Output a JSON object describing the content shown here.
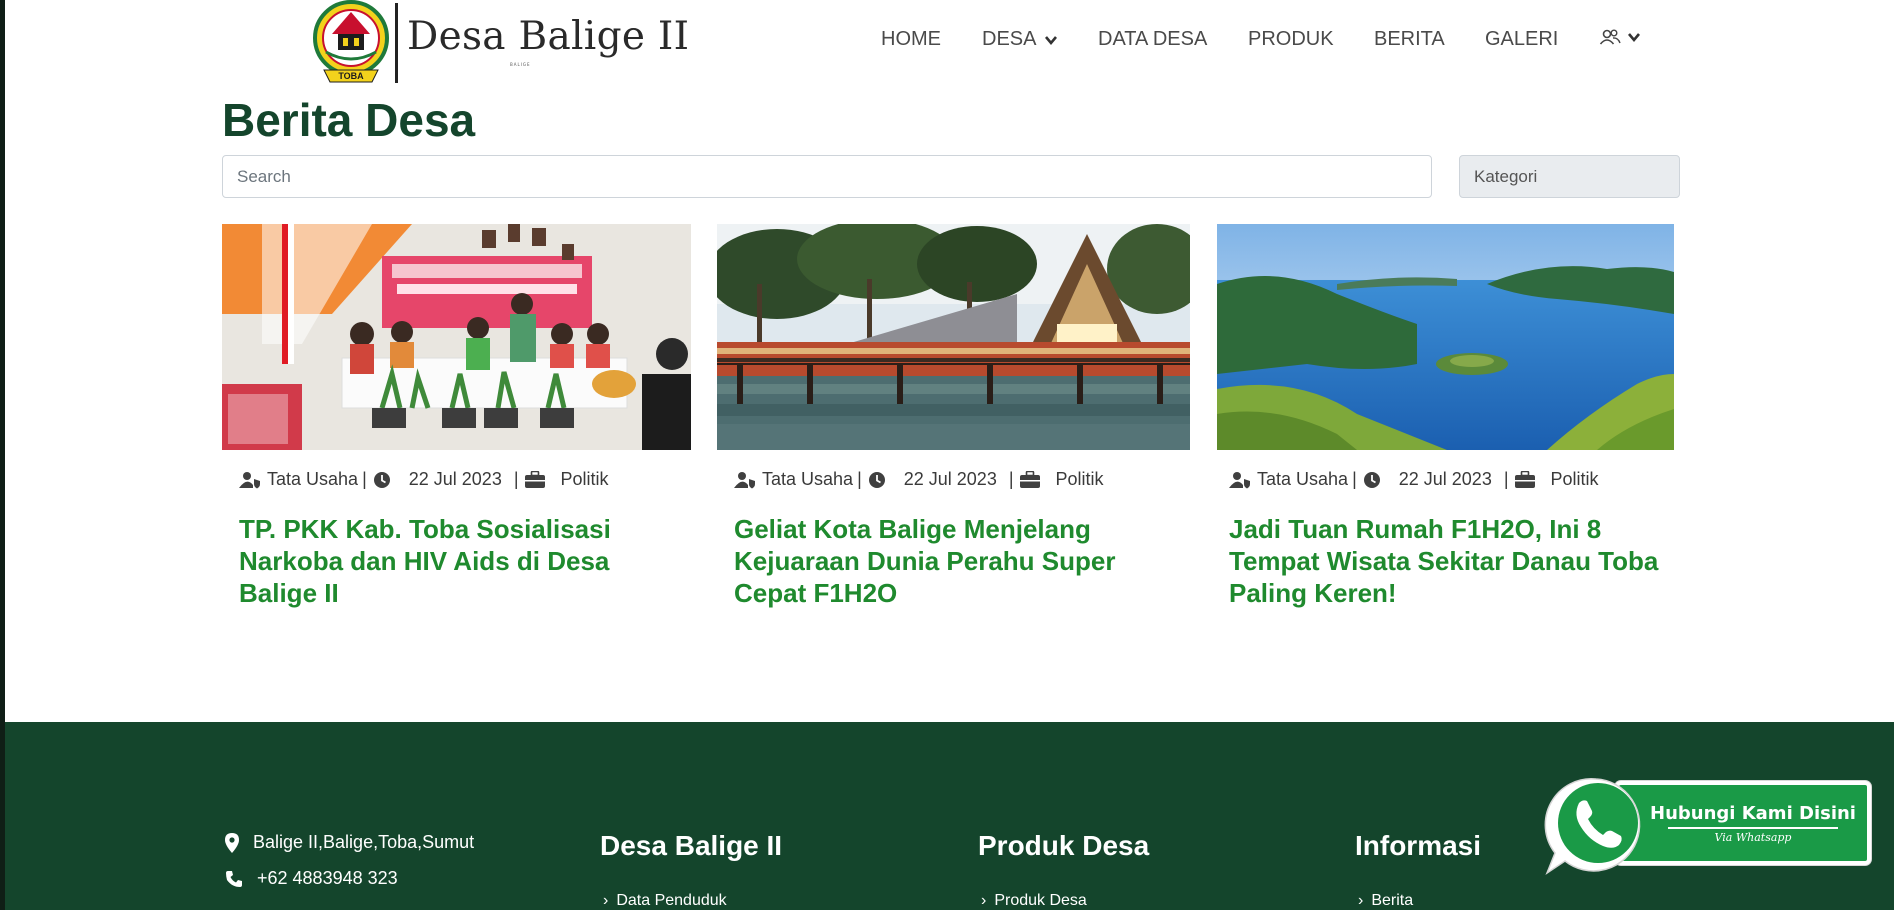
{
  "header": {
    "logo_text": "Desa Balige II",
    "logo_subtext": "BALIGE",
    "emblem_text": "TOBA",
    "nav": [
      {
        "label": "HOME"
      },
      {
        "label": "DESA"
      },
      {
        "label": "DATA DESA"
      },
      {
        "label": "PRODUK"
      },
      {
        "label": "BERITA"
      },
      {
        "label": "GALERI"
      }
    ]
  },
  "main": {
    "title": "Berita Desa",
    "search_placeholder": "Search",
    "kategori_label": "Kategori",
    "cards": [
      {
        "author": "Tata Usaha",
        "date": "22 Jul 2023",
        "category": "Politik",
        "title": "TP. PKK Kab. Toba Sosialisasi Narkoba dan HIV Aids di Desa Balige II",
        "image": "meeting-photo"
      },
      {
        "author": "Tata Usaha",
        "date": "22 Jul 2023",
        "category": "Politik",
        "title": "Geliat Kota Balige Menjelang Kejuaraan Dunia Perahu Super Cepat F1H2O",
        "image": "lakeside-pier-photo"
      },
      {
        "author": "Tata Usaha",
        "date": "22 Jul 2023",
        "category": "Politik",
        "title": "Jadi Tuan Rumah F1H2O, Ini 8 Tempat Wisata Sekitar Danau Toba Paling Keren!",
        "image": "lake-toba-photo"
      }
    ]
  },
  "footer": {
    "address": "Balige II,Balige,Toba,Sumut",
    "phone": "+62 4883948 323",
    "columns": [
      {
        "heading": "Desa Balige II",
        "first_link": "Data Penduduk"
      },
      {
        "heading": "Produk Desa",
        "first_link": "Produk Desa"
      },
      {
        "heading": "Informasi",
        "first_link": "Berita"
      }
    ],
    "background_color": "#14452c"
  },
  "whatsapp": {
    "label": "Hubungi Kami Disini",
    "sublabel": "Via Whatsapp",
    "color": "#1a9a47"
  },
  "colors": {
    "title_green": "#14452c",
    "card_title_green": "#1f8a2e"
  }
}
